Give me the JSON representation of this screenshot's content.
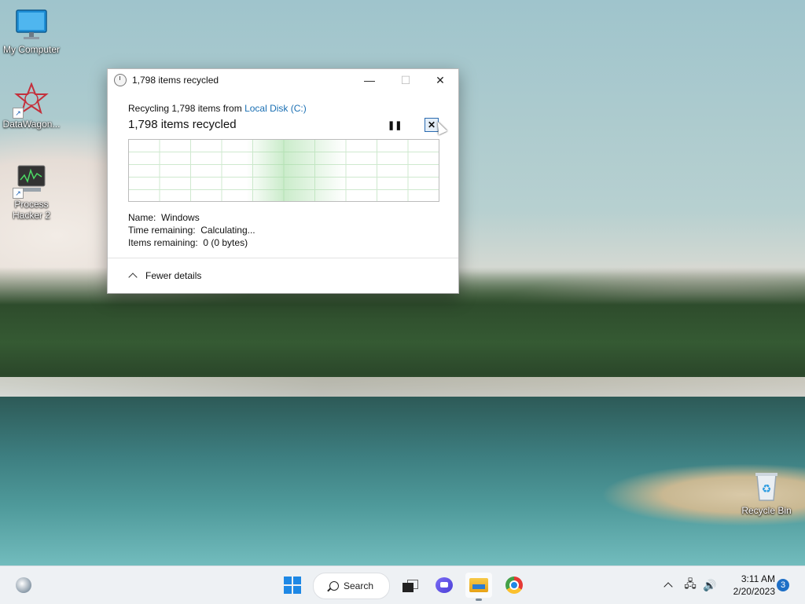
{
  "desktop": {
    "icons": [
      {
        "label": "My Computer",
        "icon": "monitor-icon"
      },
      {
        "label": "DataWagon...",
        "icon": "datawagon-icon"
      },
      {
        "label": "Process Hacker 2",
        "icon": "process-hacker-icon"
      },
      {
        "label": "Recycle Bin",
        "icon": "recycle-bin-icon"
      }
    ]
  },
  "dialog": {
    "title": "1,798 items recycled",
    "minimize_glyph": "—",
    "maximize_glyph": "☐",
    "close_glyph": "✕",
    "recycling_prefix": "Recycling 1,798 items from ",
    "source_link": "Local Disk (C:)",
    "status": "1,798 items recycled",
    "pause_glyph": "❚❚",
    "stop_glyph": "✕",
    "details": {
      "name_label": "Name:",
      "name_value": "Windows",
      "time_label": "Time remaining:",
      "time_value": "Calculating...",
      "items_label": "Items remaining:",
      "items_value": "0 (0 bytes)"
    },
    "fewer_details": "Fewer details"
  },
  "taskbar": {
    "search_label": "Search",
    "time": "3:11 AM",
    "date": "2/20/2023",
    "notification_count": "3",
    "network_glyph": "🖧",
    "volume_glyph": "🔊"
  }
}
